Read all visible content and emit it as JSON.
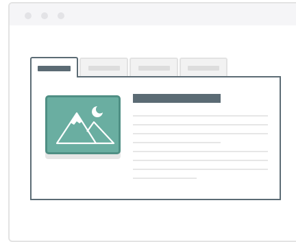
{
  "window": {
    "title": ""
  },
  "tabs": [
    {
      "label": "",
      "active": true
    },
    {
      "label": "",
      "active": false
    },
    {
      "label": "",
      "active": false
    },
    {
      "label": "",
      "active": false
    }
  ],
  "content": {
    "image_icon": "mountain-moon-image-icon",
    "headline": "",
    "text_lines": [
      "",
      "",
      "",
      "",
      "",
      "",
      "",
      ""
    ]
  },
  "colors": {
    "frame_border": "#e3e3e3",
    "titlebar": "#f5f5f7",
    "titlebar_dots": "#e3e3e6",
    "panel_border": "#5b6b74",
    "headline_placeholder": "#5b6b74",
    "text_placeholder": "#e6e6e6",
    "inactive_tab": "#f2f2f2",
    "inactive_tab_bar": "#dddddd",
    "image_fill": "#6aaea1",
    "image_border": "#4f8f84",
    "image_shadow": "#e6e6e6"
  }
}
